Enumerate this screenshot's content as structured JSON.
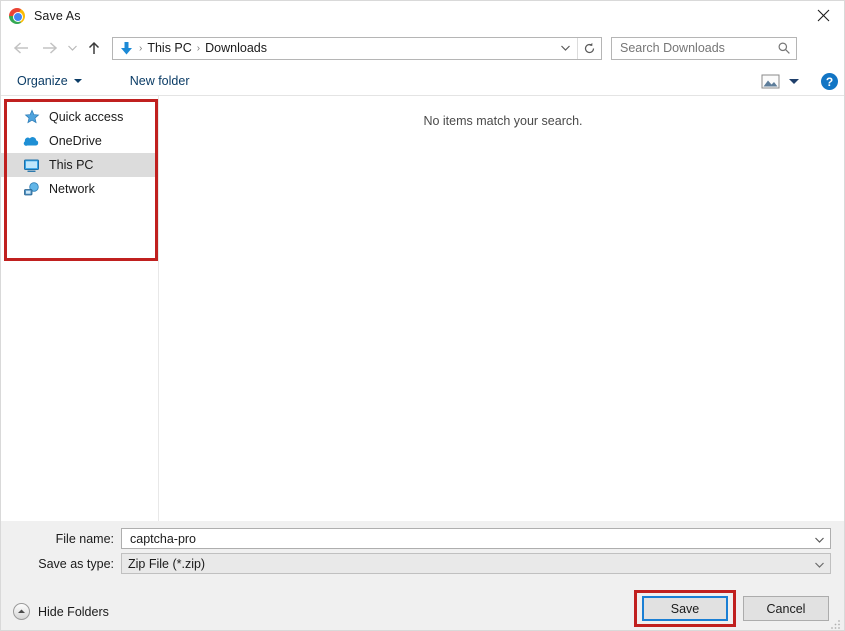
{
  "window": {
    "title": "Save As",
    "app_icon": "chrome-logo-icon",
    "close_label": "✕"
  },
  "nav": {
    "back_icon": "back-arrow-icon",
    "forward_icon": "forward-arrow-icon",
    "recent_icon": "recent-locations-chevron-icon",
    "up_icon": "up-arrow-icon",
    "address": {
      "folder_icon": "downloads-folder-icon",
      "crumbs": [
        "This PC",
        "Downloads"
      ],
      "separator": "›",
      "dropdown_icon": "chevron-down-icon",
      "refresh_icon": "refresh-icon"
    },
    "search": {
      "placeholder": "Search Downloads",
      "value": "",
      "icon": "search-icon"
    }
  },
  "toolbar": {
    "organize_label": "Organize",
    "new_folder_label": "New folder",
    "view_icon": "view-options-icon",
    "view_caret_icon": "chevron-down-icon",
    "help_label": "?",
    "help_icon": "help-icon"
  },
  "sidebar": {
    "items": [
      {
        "label": "Quick access",
        "icon": "star-icon",
        "selected": false
      },
      {
        "label": "OneDrive",
        "icon": "cloud-icon",
        "selected": false
      },
      {
        "label": "This PC",
        "icon": "monitor-icon",
        "selected": true
      },
      {
        "label": "Network",
        "icon": "network-icon",
        "selected": false
      }
    ]
  },
  "filelist": {
    "empty_message": "No items match your search."
  },
  "form": {
    "filename_label": "File name:",
    "filename_value": "captcha-pro",
    "filetype_label": "Save as type:",
    "filetype_value": "Zip File (*.zip)",
    "dropdown_icon": "chevron-down-icon",
    "hide_folders_label": "Hide Folders",
    "hide_folders_icon": "chevron-up-circle-icon",
    "save_label": "Save",
    "cancel_label": "Cancel"
  },
  "annotations": {
    "sidebar_highlight_color": "#C0201F",
    "save_highlight_color": "#C0201F",
    "focus_color": "#1A7FD4"
  }
}
